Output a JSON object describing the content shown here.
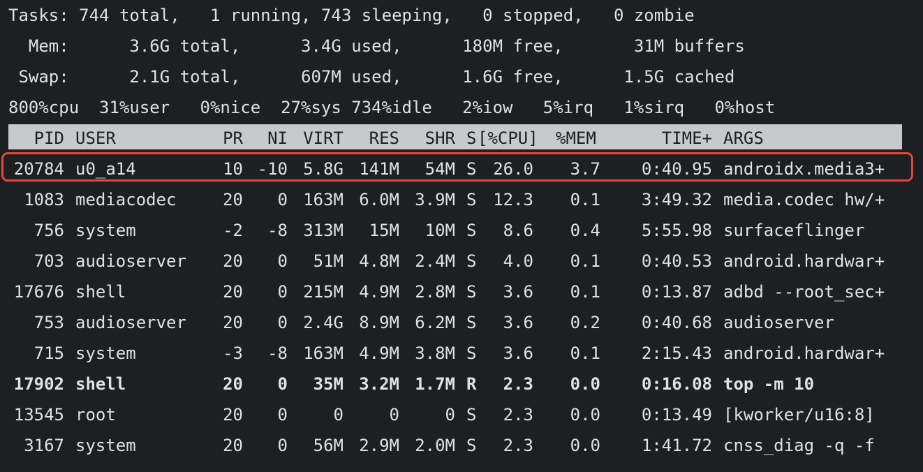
{
  "summary": [
    "Tasks: 744 total,   1 running, 743 sleeping,   0 stopped,   0 zombie",
    "  Mem:      3.6G total,      3.4G used,      180M free,       31M buffers",
    " Swap:      2.1G total,      607M used,      1.6G free,      1.5G cached",
    "800%cpu  31%user   0%nice  27%sys 734%idle   2%iow   5%irq   1%sirq   0%host"
  ],
  "columns": [
    "PID",
    "USER",
    "PR",
    "NI",
    "VIRT",
    "RES",
    "SHR",
    "S",
    "[%CPU]",
    "%MEM",
    "TIME+",
    "ARGS"
  ],
  "processes": [
    {
      "pid": "20784",
      "user": "u0_a14",
      "pr": "10",
      "ni": "-10",
      "virt": "5.8G",
      "res": "141M",
      "shr": "54M",
      "s": "S",
      "cpu": "26.0",
      "mem": "3.7",
      "time": "0:40.95",
      "args": "androidx.media3+"
    },
    {
      "pid": "1083",
      "user": "mediacodec",
      "pr": "20",
      "ni": "0",
      "virt": "163M",
      "res": "6.0M",
      "shr": "3.9M",
      "s": "S",
      "cpu": "12.3",
      "mem": "0.1",
      "time": "3:49.32",
      "args": "media.codec hw/+"
    },
    {
      "pid": "756",
      "user": "system",
      "pr": "-2",
      "ni": "-8",
      "virt": "313M",
      "res": "15M",
      "shr": "10M",
      "s": "S",
      "cpu": "8.6",
      "mem": "0.4",
      "time": "5:55.98",
      "args": "surfaceflinger"
    },
    {
      "pid": "703",
      "user": "audioserver",
      "pr": "20",
      "ni": "0",
      "virt": "51M",
      "res": "4.8M",
      "shr": "2.4M",
      "s": "S",
      "cpu": "4.0",
      "mem": "0.1",
      "time": "0:40.53",
      "args": "android.hardwar+"
    },
    {
      "pid": "17676",
      "user": "shell",
      "pr": "20",
      "ni": "0",
      "virt": "215M",
      "res": "4.9M",
      "shr": "2.8M",
      "s": "S",
      "cpu": "3.6",
      "mem": "0.1",
      "time": "0:13.87",
      "args": "adbd --root_sec+"
    },
    {
      "pid": "753",
      "user": "audioserver",
      "pr": "20",
      "ni": "0",
      "virt": "2.4G",
      "res": "8.9M",
      "shr": "6.2M",
      "s": "S",
      "cpu": "3.6",
      "mem": "0.2",
      "time": "0:40.68",
      "args": "audioserver"
    },
    {
      "pid": "715",
      "user": "system",
      "pr": "-3",
      "ni": "-8",
      "virt": "163M",
      "res": "4.9M",
      "shr": "3.8M",
      "s": "S",
      "cpu": "3.6",
      "mem": "0.1",
      "time": "2:15.43",
      "args": "android.hardwar+"
    },
    {
      "pid": "17902",
      "user": "shell",
      "pr": "20",
      "ni": "0",
      "virt": "35M",
      "res": "3.2M",
      "shr": "1.7M",
      "s": "R",
      "cpu": "2.3",
      "mem": "0.0",
      "time": "0:16.08",
      "args": "top -m 10",
      "bold": true
    },
    {
      "pid": "13545",
      "user": "root",
      "pr": "20",
      "ni": "0",
      "virt": "0",
      "res": "0",
      "shr": "0",
      "s": "S",
      "cpu": "2.3",
      "mem": "0.0",
      "time": "0:13.49",
      "args": "[kworker/u16:8]"
    },
    {
      "pid": "3167",
      "user": "system",
      "pr": "20",
      "ni": "0",
      "virt": "56M",
      "res": "2.9M",
      "shr": "2.0M",
      "s": "S",
      "cpu": "2.3",
      "mem": "0.0",
      "time": "1:41.72",
      "args": "cnss_diag -q -f"
    }
  ],
  "colors": {
    "background": "#1e1f22",
    "foreground": "#dfe1e5",
    "header_bar": "#c7c9cc",
    "highlight": "#e5483a"
  }
}
